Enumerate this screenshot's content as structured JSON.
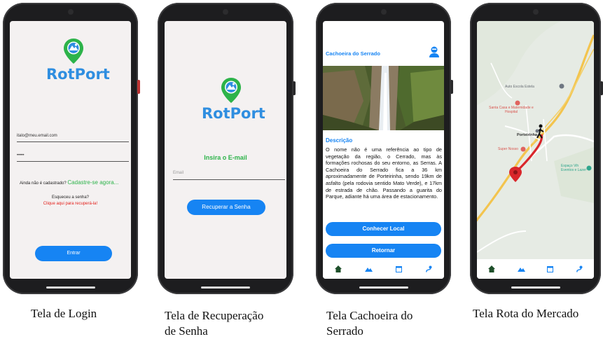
{
  "login": {
    "brand": "RotPort",
    "email_value": "italo@meu.email.com",
    "password_value": "•••••",
    "signup_prompt": "Ainda não é cadastrado?",
    "signup_link": "Cadastre-se agora...",
    "forgot_prompt": "Esqueceu a senha?",
    "forgot_link": "Clique aqui para recuperá-la!",
    "submit_label": "Entrar",
    "caption": "Tela de Login"
  },
  "recovery": {
    "brand": "RotPort",
    "heading": "Insira o E-mail",
    "email_placeholder": "Email",
    "submit_label": "Recuperar a Senha",
    "caption_line1": "Tela de Recuperação",
    "caption_line2": "de Senha"
  },
  "place": {
    "title": "Cachoeira do Serrado",
    "section_title": "Descrição",
    "description": "O nome não é uma referência ao tipo de vegetação da região, o Cerrado, mas às formações rochosas do seu entorno, as Serras. A Cachoeira do Serrado fica a 36 km aproximadamente de Porteirinha, sendo 19km de asfalto (pela rodovia sentido Mato Verde), e 17km de estrada de chão. Passando a guarita do Parque, adiante há uma área de estacionamento.",
    "primary_button": "Conhecer Local",
    "secondary_button": "Retornar",
    "caption_line1": "Tela Cachoeira do",
    "caption_line2": "Serrado"
  },
  "map": {
    "labels": {
      "auto_escola": "Auto Escola Estela",
      "santa_casa": "Santa Casa e Maternidade e Hospital",
      "porteirinha": "Porteirinha",
      "super_nosso": "Super Nosso",
      "espaco": "Espaço Vih Eventos e Lazer"
    },
    "caption": "Tela Rota do Mercado"
  },
  "nav_icons": [
    "home-icon",
    "mountain-icon",
    "calendar-icon",
    "route-icon"
  ],
  "colors": {
    "brand_blue": "#1684f3",
    "logo_blue": "#2f8ee0",
    "logo_green": "#2db34a",
    "link_green": "#2db34a",
    "link_red": "#e3201b",
    "route_red": "#d9262b",
    "bg": "#f4f1f1"
  }
}
